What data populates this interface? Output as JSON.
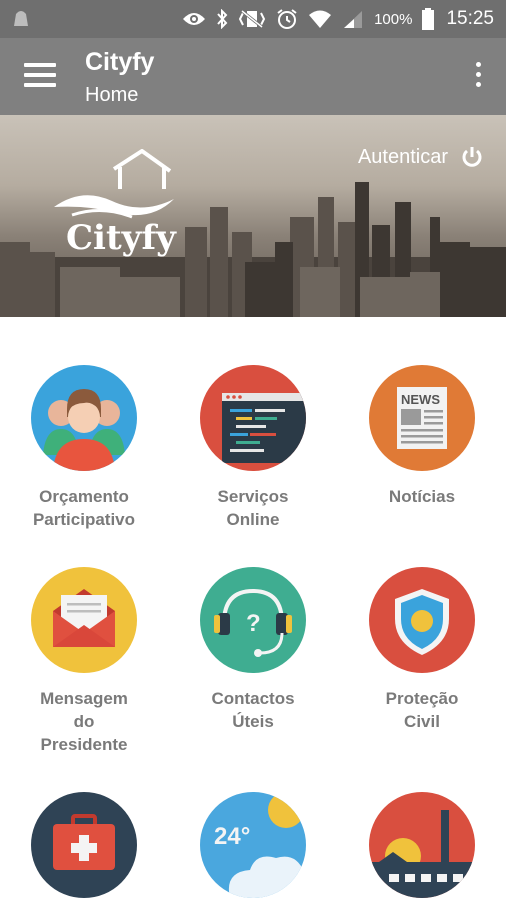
{
  "status_bar": {
    "battery": "100%",
    "time": "15:25",
    "icons": [
      "android-icon",
      "eye-icon",
      "bluetooth-icon",
      "vibrate-icon",
      "alarm-icon",
      "wifi-icon",
      "signal-icon",
      "battery-icon"
    ]
  },
  "app_bar": {
    "title": "Cityfy",
    "subtitle": "Home"
  },
  "banner": {
    "login_label": "Autenticar",
    "brand_name": "Cityfy"
  },
  "tiles": [
    {
      "label": "Orçamento\nParticipativo",
      "icon": "people-icon",
      "color": "#3aa3dc"
    },
    {
      "label": "Serviços\nOnline",
      "icon": "code-window-icon",
      "color": "#d94f3f"
    },
    {
      "label": "Notícias",
      "icon": "newspaper-icon",
      "color": "#e07a36"
    },
    {
      "label": "Mensagem\ndo\nPresidente",
      "icon": "envelope-icon",
      "color": "#f0c23c"
    },
    {
      "label": "Contactos\nÚteis",
      "icon": "headset-icon",
      "color": "#3fad91"
    },
    {
      "label": "Proteção\nCivil",
      "icon": "shield-icon",
      "color": "#d94f3f"
    },
    {
      "label": "",
      "icon": "first-aid-icon",
      "color": "#2f4355"
    },
    {
      "label": "",
      "icon": "weather-icon",
      "color": "#4aa7de",
      "temperature": "24°"
    },
    {
      "label": "",
      "icon": "factory-icon",
      "color": "#d94f3f"
    }
  ]
}
